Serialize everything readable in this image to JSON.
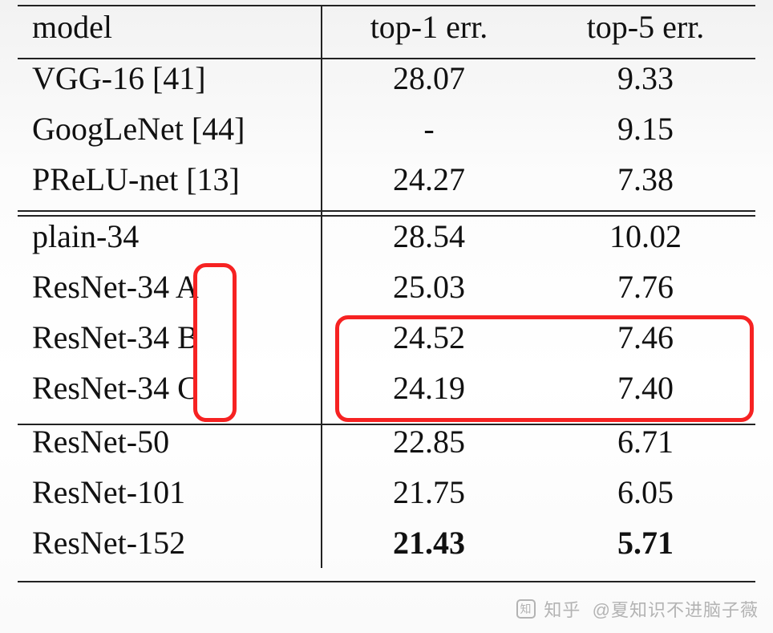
{
  "chart_data": {
    "type": "table",
    "columns": [
      "model",
      "top-1 err.",
      "top-5 err."
    ],
    "groups": [
      {
        "rows": [
          {
            "model": "VGG-16 [41]",
            "top1": "28.07",
            "top5": "9.33"
          },
          {
            "model": "GoogLeNet [44]",
            "top1": "-",
            "top5": "9.15"
          },
          {
            "model": "PReLU-net [13]",
            "top1": "24.27",
            "top5": "7.38"
          }
        ]
      },
      {
        "rows": [
          {
            "model": "plain-34",
            "top1": "28.54",
            "top5": "10.02"
          },
          {
            "model": "ResNet-34 A",
            "top1": "25.03",
            "top5": "7.76"
          },
          {
            "model": "ResNet-34 B",
            "top1": "24.52",
            "top5": "7.46"
          },
          {
            "model": "ResNet-34 C",
            "top1": "24.19",
            "top5": "7.40"
          }
        ]
      },
      {
        "rows": [
          {
            "model": "ResNet-50",
            "top1": "22.85",
            "top5": "6.71"
          },
          {
            "model": "ResNet-101",
            "top1": "21.75",
            "top5": "6.05"
          },
          {
            "model": "ResNet-152",
            "top1": "21.43",
            "top5": "5.71",
            "bold": true
          }
        ]
      }
    ]
  },
  "header": {
    "c0": "model",
    "c1": "top-1 err.",
    "c2": "top-5 err."
  },
  "rows": {
    "0": {
      "model": "VGG-16 [41]",
      "top1": "28.07",
      "top5": "9.33"
    },
    "1": {
      "model": "GoogLeNet [44]",
      "top1": "-",
      "top5": "9.15"
    },
    "2": {
      "model": "PReLU-net [13]",
      "top1": "24.27",
      "top5": "7.38"
    },
    "3": {
      "model": "plain-34",
      "top1": "28.54",
      "top5": "10.02"
    },
    "4": {
      "model": "ResNet-34 A",
      "top1": "25.03",
      "top5": "7.76"
    },
    "5": {
      "model": "ResNet-34 B",
      "top1": "24.52",
      "top5": "7.46"
    },
    "6": {
      "model": "ResNet-34 C",
      "top1": "24.19",
      "top5": "7.40"
    },
    "7": {
      "model": "ResNet-50",
      "top1": "22.85",
      "top5": "6.71"
    },
    "8": {
      "model": "ResNet-101",
      "top1": "21.75",
      "top5": "6.05"
    },
    "9": {
      "model": "ResNet-152",
      "top1": "21.43",
      "top5": "5.71"
    }
  },
  "watermark": {
    "site": "知乎",
    "handle": "@夏知识不进脑子薇"
  }
}
